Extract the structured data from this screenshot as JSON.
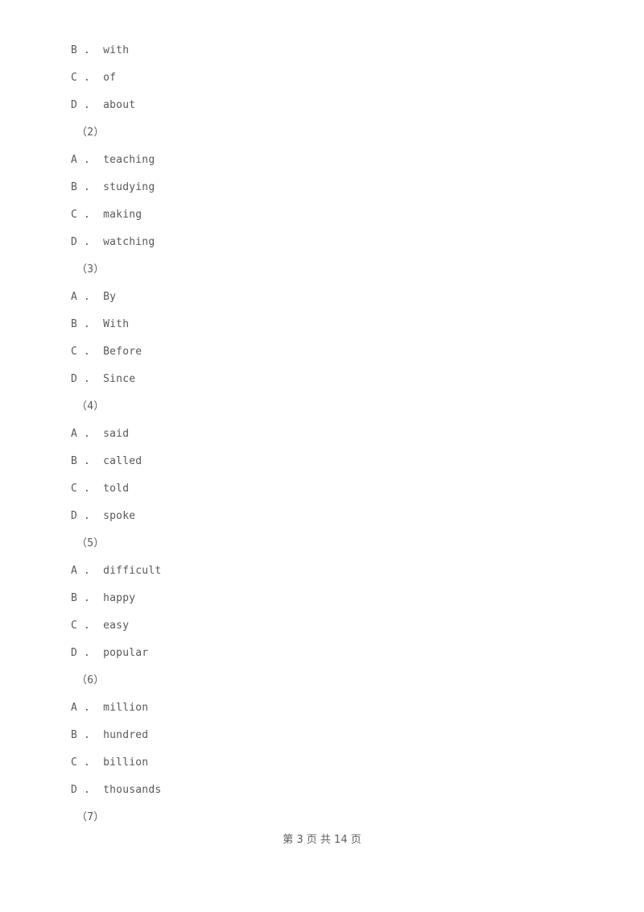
{
  "document": {
    "page_background": "#ffffff",
    "text_color": "#59595c"
  },
  "body_lines": [
    {
      "type": "option",
      "text": "B .  with"
    },
    {
      "type": "option",
      "text": "C .  of"
    },
    {
      "type": "option",
      "text": "D .  about"
    },
    {
      "type": "group",
      "text": "（2）"
    },
    {
      "type": "option",
      "text": "A .  teaching"
    },
    {
      "type": "option",
      "text": "B .  studying"
    },
    {
      "type": "option",
      "text": "C .  making"
    },
    {
      "type": "option",
      "text": "D .  watching"
    },
    {
      "type": "group",
      "text": "（3）"
    },
    {
      "type": "option",
      "text": "A .  By"
    },
    {
      "type": "option",
      "text": "B .  With"
    },
    {
      "type": "option",
      "text": "C .  Before"
    },
    {
      "type": "option",
      "text": "D .  Since"
    },
    {
      "type": "group",
      "text": "（4）"
    },
    {
      "type": "option",
      "text": "A .  said"
    },
    {
      "type": "option",
      "text": "B .  called"
    },
    {
      "type": "option",
      "text": "C .  told"
    },
    {
      "type": "option",
      "text": "D .  spoke"
    },
    {
      "type": "group",
      "text": "（5）"
    },
    {
      "type": "option",
      "text": "A .  difficult"
    },
    {
      "type": "option",
      "text": "B .  happy"
    },
    {
      "type": "option",
      "text": "C .  easy"
    },
    {
      "type": "option",
      "text": "D .  popular"
    },
    {
      "type": "group",
      "text": "（6）"
    },
    {
      "type": "option",
      "text": "A .  million"
    },
    {
      "type": "option",
      "text": "B .  hundred"
    },
    {
      "type": "option",
      "text": "C .  billion"
    },
    {
      "type": "option",
      "text": "D .  thousands"
    },
    {
      "type": "group",
      "text": "（7）"
    }
  ],
  "footer": {
    "text": "第 3 页 共 14 页",
    "current_page": "3",
    "total_pages": "14"
  }
}
